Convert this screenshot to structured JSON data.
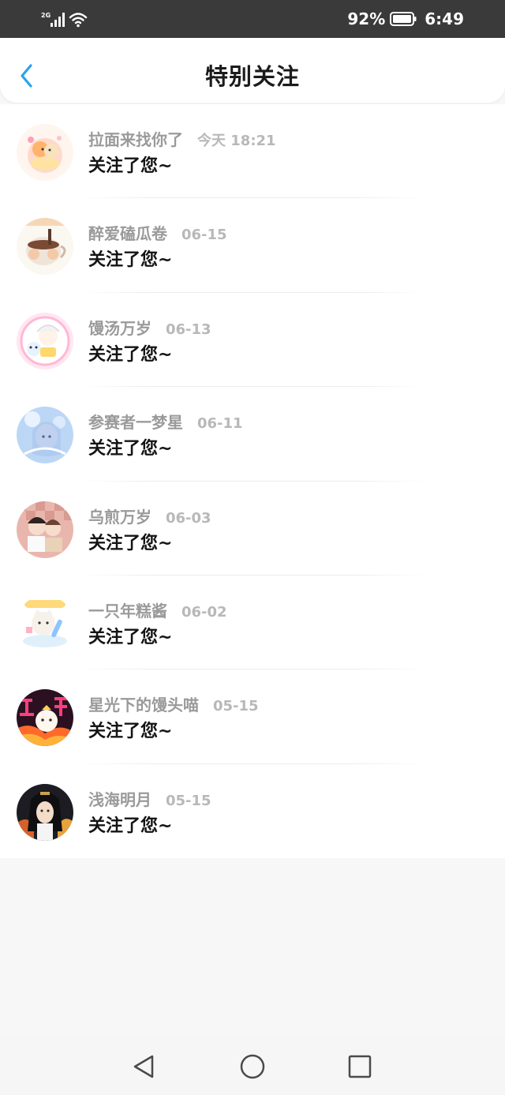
{
  "status_bar": {
    "network": "2G",
    "battery_percent": "92%",
    "time": "6:49",
    "icons": [
      "signal-icon",
      "wifi-icon",
      "battery-icon"
    ]
  },
  "header": {
    "title": "特别关注",
    "back_icon": "chevron-left-icon",
    "accent_color": "#2aa3e8"
  },
  "notifications": [
    {
      "name": "拉面来找你了",
      "date": "今天 18:21",
      "message": "关注了您~"
    },
    {
      "name": "醉爱磕瓜卷",
      "date": "06-15",
      "message": "关注了您~"
    },
    {
      "name": "馒汤万岁",
      "date": "06-13",
      "message": "关注了您~"
    },
    {
      "name": "参赛者一梦星",
      "date": "06-11",
      "message": "关注了您~"
    },
    {
      "name": "乌煎万岁",
      "date": "06-03",
      "message": "关注了您~"
    },
    {
      "name": "一只年糕酱",
      "date": "06-02",
      "message": "关注了您~"
    },
    {
      "name": "星光下的馒头喵",
      "date": "05-15",
      "message": "关注了您~"
    },
    {
      "name": "浅海明月",
      "date": "05-15",
      "message": "关注了您~"
    }
  ],
  "nav_bar": {
    "buttons": [
      "back-triangle-icon",
      "home-circle-icon",
      "recents-square-icon"
    ]
  }
}
